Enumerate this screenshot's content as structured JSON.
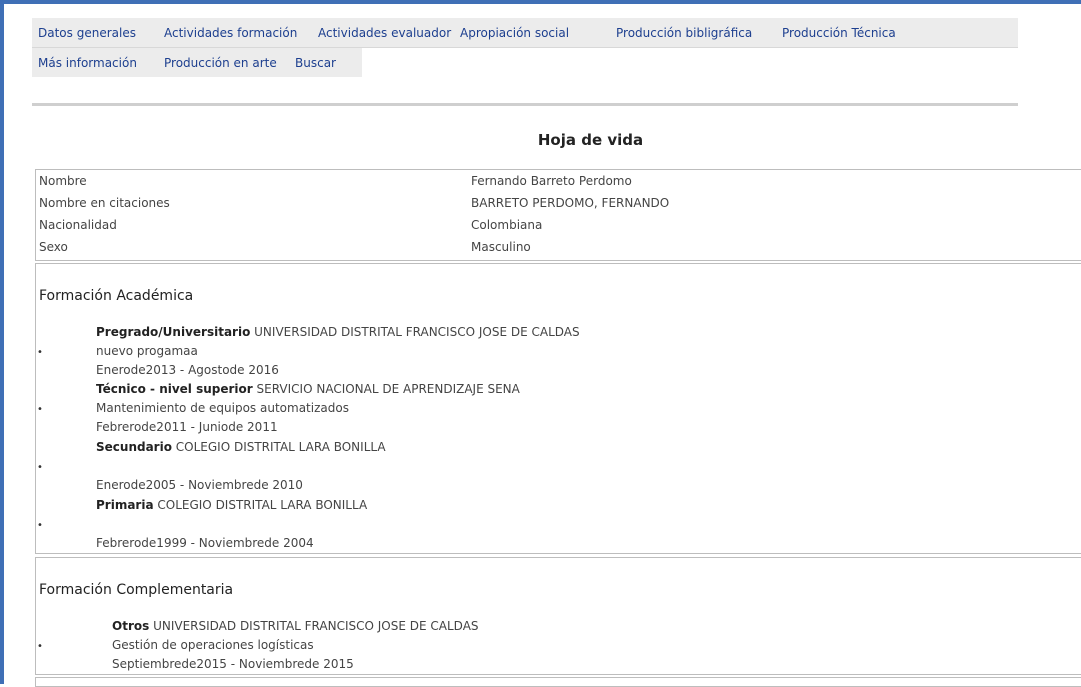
{
  "nav": {
    "row1": [
      "Datos generales",
      "Actividades formación",
      "Actividades evaluador",
      "Apropiación social",
      "Producción bibligráfica",
      "Producción Técnica"
    ],
    "row2": [
      "Más información",
      "Producción en arte",
      "Buscar"
    ]
  },
  "page_title": "Hoja de vida",
  "general": [
    {
      "label": "Nombre",
      "value": "Fernando Barreto  Perdomo"
    },
    {
      "label": "Nombre en citaciones",
      "value": "BARRETO PERDOMO, FERNANDO"
    },
    {
      "label": "Nacionalidad",
      "value": "Colombiana"
    },
    {
      "label": "Sexo",
      "value": "Masculino"
    }
  ],
  "academic": {
    "title": "Formación Académica",
    "entries": [
      {
        "level": "Pregrado/Universitario",
        "institution": " UNIVERSIDAD DISTRITAL FRANCISCO JOSE DE CALDAS",
        "program": "nuevo progamaa",
        "dates": "Enerode2013 - Agostode 2016"
      },
      {
        "level": "Técnico - nivel superior",
        "institution": " SERVICIO NACIONAL DE APRENDIZAJE SENA",
        "program": "Mantenimiento de equipos automatizados",
        "dates": "Febrerode2011 - Juniode 2011"
      },
      {
        "level": "Secundario",
        "institution": " COLEGIO DISTRITAL LARA BONILLA",
        "program": "",
        "dates": "Enerode2005 - Noviembrede 2010"
      },
      {
        "level": "Primaria",
        "institution": " COLEGIO DISTRITAL LARA BONILLA",
        "program": "",
        "dates": "Febrerode1999 - Noviembrede 2004"
      }
    ]
  },
  "complementary": {
    "title": "Formación Complementaria",
    "entries": [
      {
        "level": "Otros",
        "institution": " UNIVERSIDAD DISTRITAL FRANCISCO JOSE DE CALDAS",
        "program": "Gestión de operaciones logísticas",
        "dates": "Septiembrede2015 - Noviembrede 2015"
      }
    ]
  },
  "colors": {
    "link": "#1d3f8f",
    "frame": "#3f6fb6"
  }
}
